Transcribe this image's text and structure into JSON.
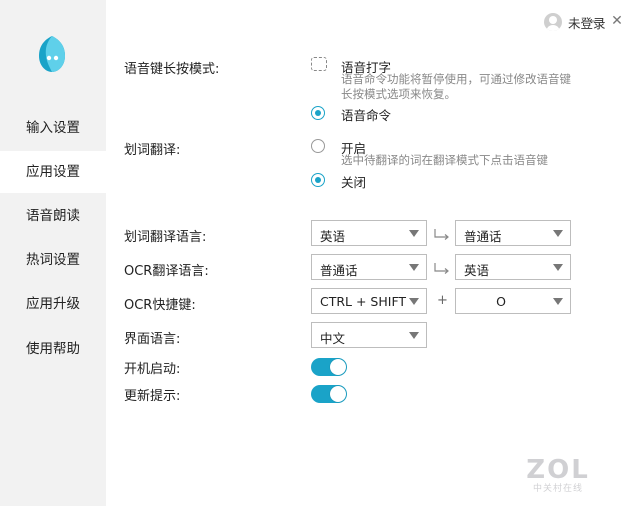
{
  "header": {
    "login_label": "未登录",
    "minimize": "—",
    "close": "✕"
  },
  "sidebar": {
    "items": [
      {
        "label": "输入设置"
      },
      {
        "label": "应用设置"
      },
      {
        "label": "语音朗读"
      },
      {
        "label": "热词设置"
      },
      {
        "label": "应用升级"
      },
      {
        "label": "使用帮助"
      }
    ],
    "active_index": 1
  },
  "settings": {
    "voice_key": {
      "label": "语音键长按模式:",
      "opt1": "语音打字",
      "opt1_desc": [
        "语音命令功能将暂停使用，可通过修改语音键",
        "长按模式选项来恢复。"
      ],
      "opt2": "语音命令",
      "selected": "语音命令"
    },
    "word_translate": {
      "label": "划词翻译:",
      "opt1": "开启",
      "opt1_desc": "选中待翻译的词在翻译模式下点击语音键",
      "opt2": "关闭",
      "selected": "关闭"
    },
    "word_translate_lang": {
      "label": "划词翻译语言:",
      "from": "英语",
      "to": "普通话"
    },
    "ocr_lang": {
      "label": "OCR翻译语言:",
      "from": "普通话",
      "to": "英语"
    },
    "ocr_shortcut": {
      "label": "OCR快捷键:",
      "modifier": "CTRL + SHIFT",
      "plus": "+",
      "key": "O"
    },
    "ui_language": {
      "label": "界面语言:",
      "value": "中文"
    },
    "auto_start": {
      "label": "开机启动:",
      "on": true
    },
    "update_notice": {
      "label": "更新提示:",
      "on": true
    }
  },
  "watermark": {
    "big": "ZOL",
    "small": "中关村在线"
  },
  "colors": {
    "accent": "#1aa3c8",
    "sidebar_bg": "#f2f2f2"
  }
}
